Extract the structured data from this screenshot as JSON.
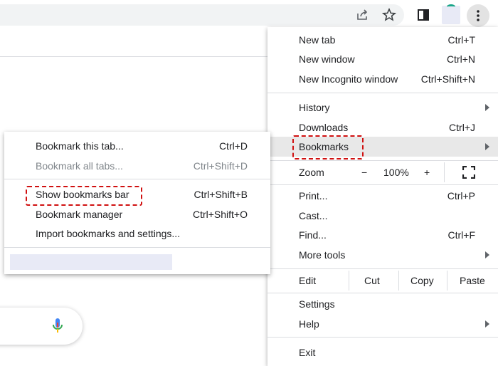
{
  "toolbar": {
    "icons": [
      "share-icon",
      "star-icon",
      "side-panel-icon",
      "kebab-menu-icon",
      "mic-icon"
    ]
  },
  "main_menu": {
    "items": [
      {
        "label": "New tab",
        "shortcut": "Ctrl+T"
      },
      {
        "label": "New window",
        "shortcut": "Ctrl+N"
      },
      {
        "label": "New Incognito window",
        "shortcut": "Ctrl+Shift+N"
      },
      {
        "label": "History"
      },
      {
        "label": "Downloads",
        "shortcut": "Ctrl+J"
      },
      {
        "label": "Bookmarks"
      },
      {
        "label": "Print...",
        "shortcut": "Ctrl+P"
      },
      {
        "label": "Cast..."
      },
      {
        "label": "Find...",
        "shortcut": "Ctrl+F"
      },
      {
        "label": "More tools"
      },
      {
        "label": "Settings"
      },
      {
        "label": "Help"
      },
      {
        "label": "Exit"
      }
    ],
    "zoom": {
      "label": "Zoom",
      "minus": "−",
      "value": "100%",
      "plus": "+"
    },
    "edit": {
      "label": "Edit",
      "cut": "Cut",
      "copy": "Copy",
      "paste": "Paste"
    }
  },
  "bookmarks_submenu": {
    "items": [
      {
        "label": "Bookmark this tab...",
        "shortcut": "Ctrl+D"
      },
      {
        "label": "Bookmark all tabs...",
        "shortcut": "Ctrl+Shift+D"
      },
      {
        "label": "Show bookmarks bar",
        "shortcut": "Ctrl+Shift+B"
      },
      {
        "label": "Bookmark manager",
        "shortcut": "Ctrl+Shift+O"
      },
      {
        "label": "Import bookmarks and settings..."
      }
    ]
  },
  "colors": {
    "highlight_dash": "#d01010",
    "menu_hover": "#e8e8e8"
  }
}
